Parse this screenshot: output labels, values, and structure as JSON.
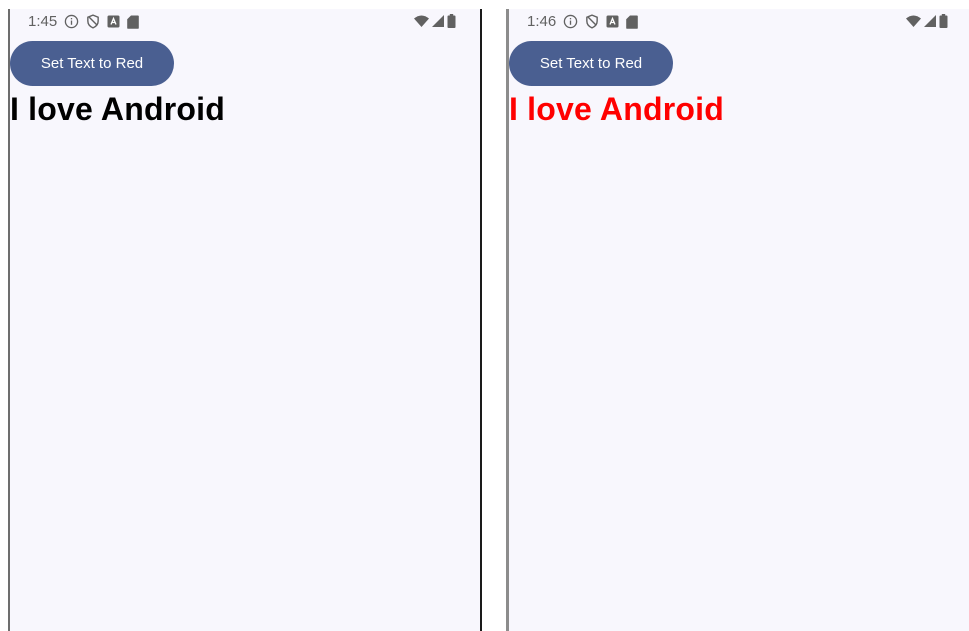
{
  "screens": [
    {
      "status_bar": {
        "time": "1:45"
      },
      "button": {
        "label": "Set Text to Red"
      },
      "text": {
        "value": "I love Android",
        "color": "#000000"
      }
    },
    {
      "status_bar": {
        "time": "1:46"
      },
      "button": {
        "label": "Set Text to Red"
      },
      "text": {
        "value": "I love Android",
        "color": "#ff0000"
      }
    }
  ],
  "colors": {
    "button_bg": "#4a5f91",
    "screen_bg": "#f8f7fd",
    "status_icon": "#616161"
  },
  "icons": {
    "status_left": [
      "info-icon",
      "shield-icon",
      "a-box-icon",
      "sd-card-icon"
    ],
    "status_right": [
      "wifi-icon",
      "signal-icon",
      "battery-icon"
    ]
  }
}
